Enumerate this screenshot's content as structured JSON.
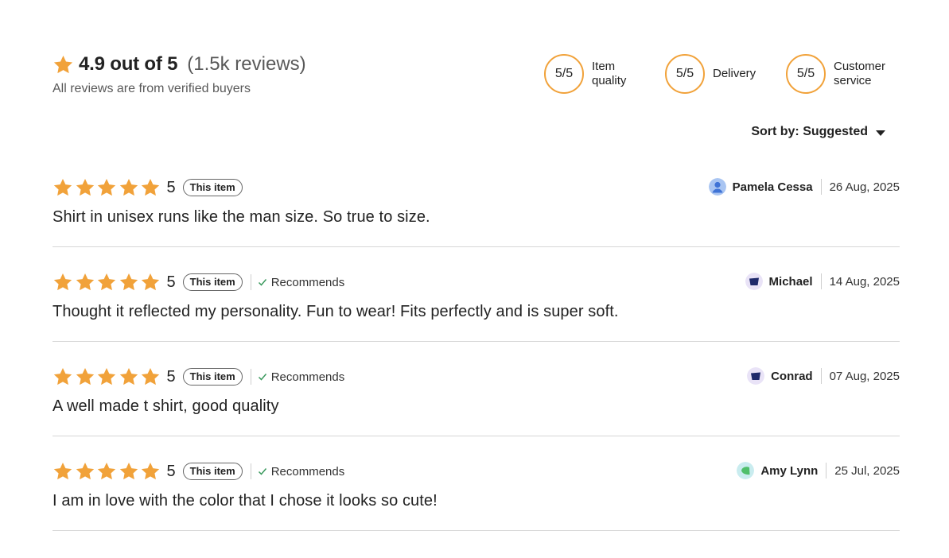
{
  "summary": {
    "score": "4.9 out of 5",
    "count": "(1.5k reviews)",
    "verified_note": "All reviews are from verified buyers",
    "star_color": "#f1a23a"
  },
  "categories": [
    {
      "score": "5/5",
      "label": "Item quality"
    },
    {
      "score": "5/5",
      "label": "Delivery"
    },
    {
      "score": "5/5",
      "label": "Customer service"
    }
  ],
  "sort": {
    "label": "Sort by: Suggested"
  },
  "reviews": [
    {
      "rating": "5",
      "stars": 5,
      "badge": "This item",
      "recommends": "",
      "text": "Shirt in unisex runs like the man size. So true to size.",
      "reviewer": "Pamela Cessa",
      "date": "26 Aug, 2025",
      "avatar_icon": "default-person-icon"
    },
    {
      "rating": "5",
      "stars": 5,
      "badge": "This item",
      "recommends": "Recommends",
      "text": "Thought it reflected my personality. Fun to wear! Fits perfectly and is super soft.",
      "reviewer": "Michael",
      "date": "14 Aug, 2025",
      "avatar_icon": "navy-shape-icon"
    },
    {
      "rating": "5",
      "stars": 5,
      "badge": "This item",
      "recommends": "Recommends",
      "text": "A well made t shirt, good quality",
      "reviewer": "Conrad",
      "date": "07 Aug, 2025",
      "avatar_icon": "navy-shape-icon"
    },
    {
      "rating": "5",
      "stars": 5,
      "badge": "This item",
      "recommends": "Recommends",
      "text": "I am in love with the color that I chose it looks so cute!",
      "reviewer": "Amy Lynn",
      "date": "25 Jul, 2025",
      "avatar_icon": "green-shape-icon"
    }
  ],
  "colors": {
    "accent": "#f1a23a",
    "divider": "#d6d6d6",
    "check": "#3c9a5f"
  }
}
